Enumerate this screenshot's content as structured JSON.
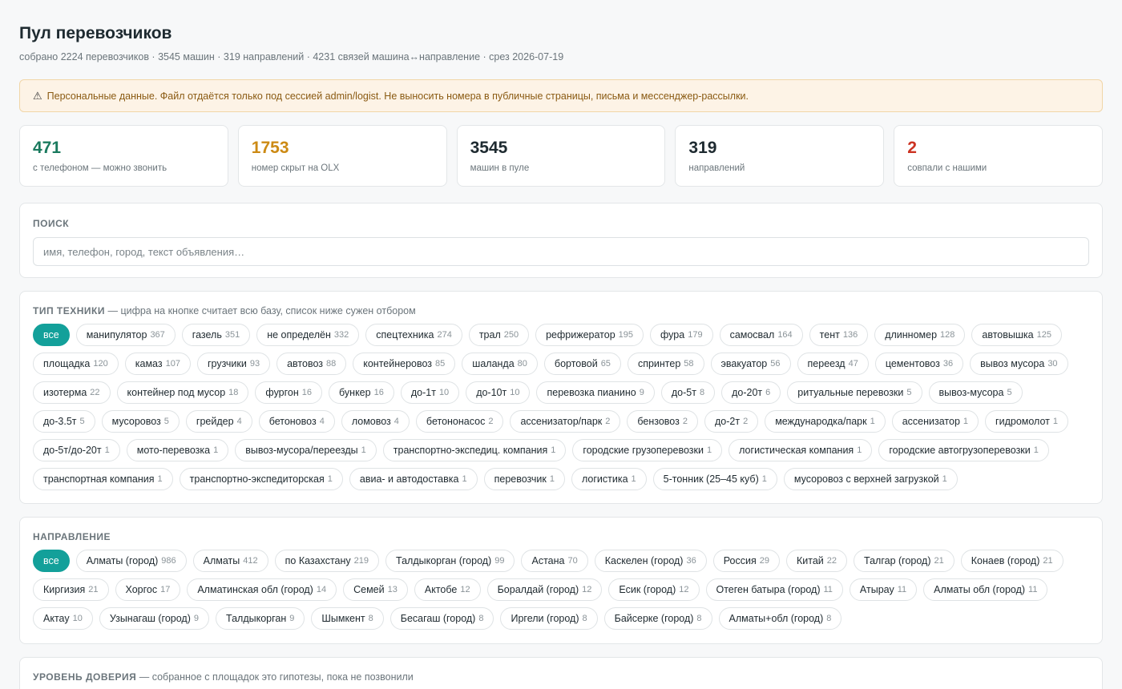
{
  "header": {
    "title": "Пул перевозчиков",
    "subtitle": "собрано 2224 перевозчиков · 3545 машин · 319 направлений · 4231 связей машина↔направление · срез 2026-07-19"
  },
  "alert": {
    "icon": "warning-icon",
    "text": "Персональные данные. Файл отдаётся только под сессией admin/logist. Не выносить номера в публичные страницы, письма и мессенджер-рассылки."
  },
  "stats": [
    {
      "value": "471",
      "label": "с телефоном — можно звонить",
      "color": "#1a7a5e"
    },
    {
      "value": "1753",
      "label": "номер скрыт на OLX",
      "color": "#cc8a14"
    },
    {
      "value": "3545",
      "label": "машин в пуле",
      "color": "#1e2a30"
    },
    {
      "value": "319",
      "label": "направлений",
      "color": "#1e2a30"
    },
    {
      "value": "2",
      "label": "совпали с нашими",
      "color": "#cc3322"
    }
  ],
  "search": {
    "title": "ПОИСК",
    "placeholder": "имя, телефон, город, текст объявления…"
  },
  "equipment": {
    "title": "ТИП ТЕХНИКИ",
    "note": " — цифра на кнопке считает всю базу, список ниже сужен отбором",
    "chips": [
      {
        "label": "все",
        "count": "",
        "active": true
      },
      {
        "label": "манипулятор",
        "count": "367"
      },
      {
        "label": "газель",
        "count": "351"
      },
      {
        "label": "не определён",
        "count": "332"
      },
      {
        "label": "спецтехника",
        "count": "274"
      },
      {
        "label": "трал",
        "count": "250"
      },
      {
        "label": "рефрижератор",
        "count": "195"
      },
      {
        "label": "фура",
        "count": "179"
      },
      {
        "label": "самосвал",
        "count": "164"
      },
      {
        "label": "тент",
        "count": "136"
      },
      {
        "label": "длинномер",
        "count": "128"
      },
      {
        "label": "автовышка",
        "count": "125"
      },
      {
        "label": "площадка",
        "count": "120"
      },
      {
        "label": "камаз",
        "count": "107"
      },
      {
        "label": "грузчики",
        "count": "93"
      },
      {
        "label": "автовоз",
        "count": "88"
      },
      {
        "label": "контейнеровоз",
        "count": "85"
      },
      {
        "label": "шаланда",
        "count": "80"
      },
      {
        "label": "бортовой",
        "count": "65"
      },
      {
        "label": "спринтер",
        "count": "58"
      },
      {
        "label": "эвакуатор",
        "count": "56"
      },
      {
        "label": "переезд",
        "count": "47"
      },
      {
        "label": "цементовоз",
        "count": "36"
      },
      {
        "label": "вывоз мусора",
        "count": "30"
      },
      {
        "label": "изотерма",
        "count": "22"
      },
      {
        "label": "контейнер под мусор",
        "count": "18"
      },
      {
        "label": "фургон",
        "count": "16"
      },
      {
        "label": "бункер",
        "count": "16"
      },
      {
        "label": "до-1т",
        "count": "10"
      },
      {
        "label": "до-10т",
        "count": "10"
      },
      {
        "label": "перевозка пианино",
        "count": "9"
      },
      {
        "label": "до-5т",
        "count": "8"
      },
      {
        "label": "до-20т",
        "count": "6"
      },
      {
        "label": "ритуальные перевозки",
        "count": "5"
      },
      {
        "label": "вывоз-мусора",
        "count": "5"
      },
      {
        "label": "до-3.5т",
        "count": "5"
      },
      {
        "label": "мусоровоз",
        "count": "5"
      },
      {
        "label": "грейдер",
        "count": "4"
      },
      {
        "label": "бетоновоз",
        "count": "4"
      },
      {
        "label": "ломовоз",
        "count": "4"
      },
      {
        "label": "бетононасос",
        "count": "2"
      },
      {
        "label": "ассенизатор/парк",
        "count": "2"
      },
      {
        "label": "бензовоз",
        "count": "2"
      },
      {
        "label": "до-2т",
        "count": "2"
      },
      {
        "label": "международка/парк",
        "count": "1"
      },
      {
        "label": "ассенизатор",
        "count": "1"
      },
      {
        "label": "гидромолот",
        "count": "1"
      },
      {
        "label": "до-5т/до-20т",
        "count": "1"
      },
      {
        "label": "мото-перевозка",
        "count": "1"
      },
      {
        "label": "вывоз-мусора/переезды",
        "count": "1"
      },
      {
        "label": "транспортно-экспедиц. компания",
        "count": "1"
      },
      {
        "label": "городские грузоперевозки",
        "count": "1"
      },
      {
        "label": "логистическая компания",
        "count": "1"
      },
      {
        "label": "городские автогрузоперевозки",
        "count": "1"
      },
      {
        "label": "транспортная компания",
        "count": "1"
      },
      {
        "label": "транспортно-экспедиторская",
        "count": "1"
      },
      {
        "label": "авиа- и автодоставка",
        "count": "1"
      },
      {
        "label": "перевозчик",
        "count": "1"
      },
      {
        "label": "логистика",
        "count": "1"
      },
      {
        "label": "5-тонник (25–45 куб)",
        "count": "1"
      },
      {
        "label": "мусоровоз с верхней загрузкой",
        "count": "1"
      }
    ]
  },
  "direction": {
    "title": "НАПРАВЛЕНИЕ",
    "chips": [
      {
        "label": "все",
        "count": "",
        "active": true
      },
      {
        "label": "Алматы (город)",
        "count": "986"
      },
      {
        "label": "Алматы",
        "count": "412"
      },
      {
        "label": "по Казахстану",
        "count": "219"
      },
      {
        "label": "Талдыкорган (город)",
        "count": "99"
      },
      {
        "label": "Астана",
        "count": "70"
      },
      {
        "label": "Каскелен (город)",
        "count": "36"
      },
      {
        "label": "Россия",
        "count": "29"
      },
      {
        "label": "Китай",
        "count": "22"
      },
      {
        "label": "Талгар (город)",
        "count": "21"
      },
      {
        "label": "Конаев (город)",
        "count": "21"
      },
      {
        "label": "Киргизия",
        "count": "21"
      },
      {
        "label": "Хоргос",
        "count": "17"
      },
      {
        "label": "Алматинская обл (город)",
        "count": "14"
      },
      {
        "label": "Семей",
        "count": "13"
      },
      {
        "label": "Актобе",
        "count": "12"
      },
      {
        "label": "Боралдай (город)",
        "count": "12"
      },
      {
        "label": "Есик (город)",
        "count": "12"
      },
      {
        "label": "Отеген батыра (город)",
        "count": "11"
      },
      {
        "label": "Атырау",
        "count": "11"
      },
      {
        "label": "Алматы обл (город)",
        "count": "11"
      },
      {
        "label": "Актау",
        "count": "10"
      },
      {
        "label": "Узынагаш (город)",
        "count": "9"
      },
      {
        "label": "Талдыкорган",
        "count": "9"
      },
      {
        "label": "Шымкент",
        "count": "8"
      },
      {
        "label": "Бесагаш (город)",
        "count": "8"
      },
      {
        "label": "Иргели (город)",
        "count": "8"
      },
      {
        "label": "Байсерке (город)",
        "count": "8"
      },
      {
        "label": "Алматы+обл (город)",
        "count": "8"
      }
    ]
  },
  "trust": {
    "title": "УРОВЕНЬ ДОВЕРИЯ",
    "note": " — собранное с площадок это гипотезы, пока не позвонили"
  }
}
